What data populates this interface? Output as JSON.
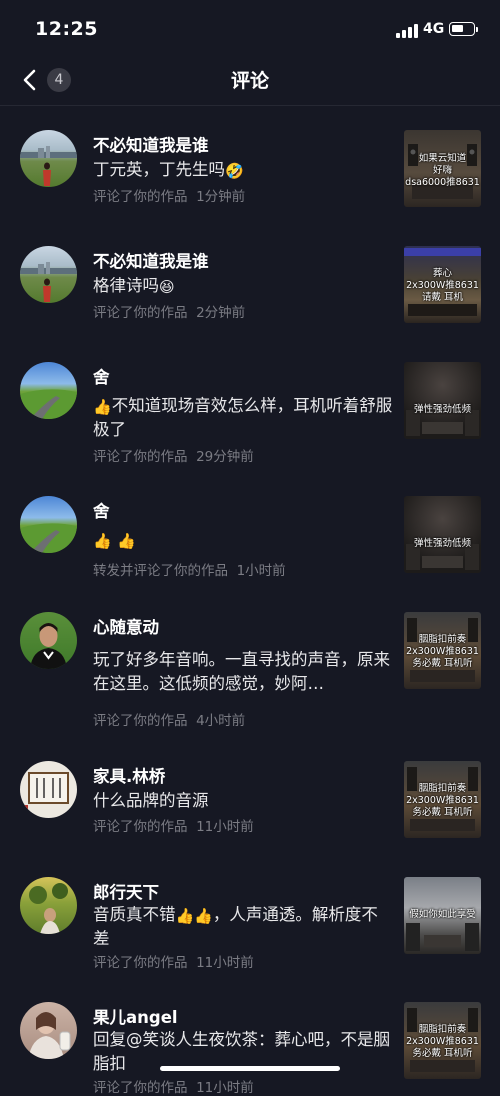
{
  "status_bar": {
    "time": "12:25",
    "network": "4G"
  },
  "nav": {
    "badge_count": "4",
    "title": "评论"
  },
  "comments": [
    {
      "name": "不必知道我是谁",
      "text_parts": [
        "丁元英，丁先生吗",
        "🤣"
      ],
      "action": "评论了你的作品",
      "time": "1分钟前",
      "thumb_caption": [
        "如果云知道",
        "好嗨",
        "dsa6000推8631"
      ]
    },
    {
      "name": "不必知道我是谁",
      "text_parts": [
        "格律诗吗",
        "😆"
      ],
      "action": "评论了你的作品",
      "time": "2分钟前",
      "thumb_caption": [
        "葬心",
        "2x300W推8631",
        "请戴   耳机"
      ]
    },
    {
      "name": "舍",
      "text_parts": [
        "👍",
        "不知道现场音效怎么样，耳机听着舒服极了"
      ],
      "action": "评论了你的作品",
      "time": "29分钟前",
      "thumb_caption": [
        "弹性强劲低频"
      ]
    },
    {
      "name": "舍",
      "text_parts": [
        "👍",
        "👍"
      ],
      "action": "转发并评论了你的作品",
      "time": "1小时前",
      "thumb_caption": [
        "弹性强劲低频"
      ]
    },
    {
      "name": "心随意动",
      "text_parts": [
        "玩了好多年音响。一直寻找的声音，原来在这里。这低频的感觉，妙阿…"
      ],
      "action": "评论了你的作品",
      "time": "4小时前",
      "thumb_caption": [
        "胭脂扣前奏",
        "2x300W推8631",
        "务必戴   耳机听"
      ]
    },
    {
      "name": "家具.林桥",
      "text_parts": [
        "什么品牌的音源"
      ],
      "action": "评论了你的作品",
      "time": "11小时前",
      "thumb_caption": [
        "胭脂扣前奏",
        "2x300W推8631",
        "务必戴   耳机听"
      ]
    },
    {
      "name": "郎行天下",
      "text_parts": [
        "音质真不错",
        "👍👍",
        "，人声通透。解析度不差"
      ],
      "action": "评论了你的作品",
      "time": "11小时前",
      "thumb_caption": [
        "假如你如此享受"
      ]
    },
    {
      "name": "果儿angel",
      "text_parts": [
        "回复@笑谈人生夜饮茶：葬心吧，不是胭脂扣"
      ],
      "action": "评论了你的作品",
      "time": "11小时前",
      "thumb_caption": [
        "胭脂扣前奏",
        "2x300W推8631",
        "务必戴   耳机听"
      ]
    }
  ],
  "colors": {
    "background": "#161823",
    "meta_text": "#7b7c84",
    "body_text": "#e8e8ea"
  }
}
